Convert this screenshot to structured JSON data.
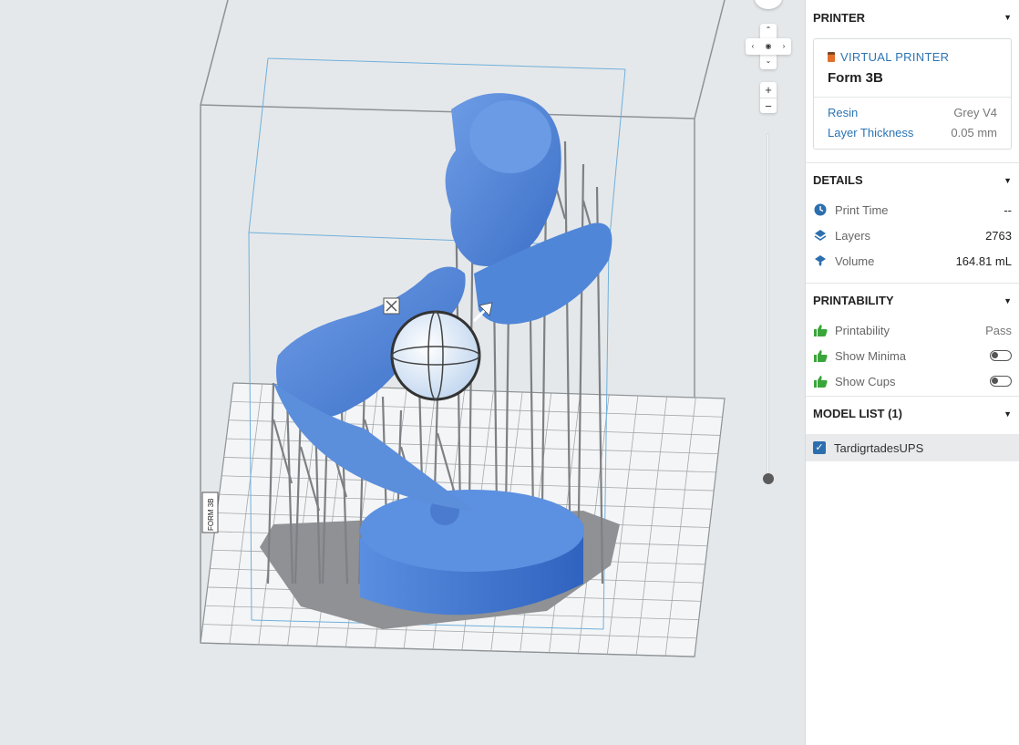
{
  "printer": {
    "section_title": "PRINTER",
    "virtual_label": "VIRTUAL PRINTER",
    "model": "Form 3B",
    "rows": [
      {
        "key": "Resin",
        "value": "Grey V4"
      },
      {
        "key": "Layer Thickness",
        "value": "0.05 mm"
      }
    ]
  },
  "details": {
    "section_title": "DETAILS",
    "rows": [
      {
        "label": "Print Time",
        "value": "--",
        "icon": "clock-icon"
      },
      {
        "label": "Layers",
        "value": "2763",
        "icon": "layers-icon"
      },
      {
        "label": "Volume",
        "value": "164.81 mL",
        "icon": "volume-icon"
      }
    ]
  },
  "printability": {
    "section_title": "PRINTABILITY",
    "rows": [
      {
        "label": "Printability",
        "value": "Pass",
        "icon": "thumbs-up-icon"
      },
      {
        "label": "Show Minima",
        "toggle": false,
        "icon": "thumbs-up-icon"
      },
      {
        "label": "Show Cups",
        "toggle": false,
        "icon": "thumbs-up-icon"
      }
    ]
  },
  "model_list": {
    "section_title": "MODEL LIST (1)",
    "items": [
      {
        "name": "TardigrtadesUPS",
        "checked": true
      }
    ]
  },
  "viewport": {
    "build_plate_label": "FORM 3B",
    "nav_glyphs": {
      "up": "⌃",
      "down": "⌄",
      "left": "‹",
      "right": "›",
      "center": "◉"
    },
    "zoom_in": "+",
    "zoom_out": "−"
  },
  "colors": {
    "accent": "#2c74b3",
    "model": "#4f86d8",
    "supports": "#8f9194",
    "pass_green": "#3aa53a"
  }
}
